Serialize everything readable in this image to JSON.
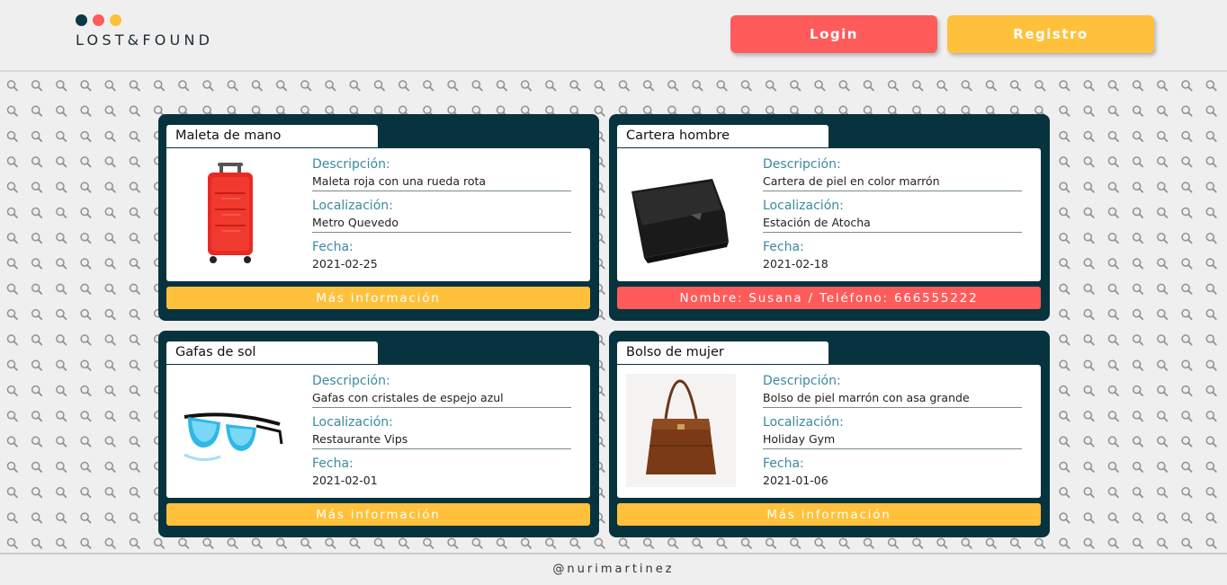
{
  "header": {
    "logo_text": "LOST&FOUND",
    "logo_dots": [
      "#0b3a47",
      "#ff5b5b",
      "#ffc13b"
    ],
    "login_label": "Login",
    "register_label": "Registro"
  },
  "colors": {
    "coral": "#ff5b5b",
    "yellow": "#ffc13b",
    "navy": "#07333f",
    "label_teal": "#3a8aa0"
  },
  "background_icon": "magnifier-icon",
  "items": [
    {
      "title": "Maleta de mano",
      "image_icon": "suitcase-image",
      "desc_label": "Descripción:",
      "desc": "Maleta roja con una rueda rota",
      "loc_label": "Localización:",
      "loc": "Metro Quevedo",
      "date_label": "Fecha:",
      "date": "2021-02-25",
      "button": "Más información"
    },
    {
      "title": "Cartera hombre",
      "image_icon": "wallet-image",
      "desc_label": "Descripción:",
      "desc": "Cartera de piel en color marrón",
      "loc_label": "Localización:",
      "loc": "Estación de Atocha",
      "date_label": "Fecha:",
      "date": "2021-02-18",
      "button": "Nombre: Susana / Teléfono: 666555222"
    },
    {
      "title": "Gafas de sol",
      "image_icon": "sunglasses-image",
      "desc_label": "Descripción:",
      "desc": "Gafas con cristales de espejo azul",
      "loc_label": "Localización:",
      "loc": "Restaurante Vips",
      "date_label": "Fecha:",
      "date": "2021-02-01",
      "button": "Más información"
    },
    {
      "title": "Bolso de mujer",
      "image_icon": "handbag-image",
      "desc_label": "Descripción:",
      "desc": "Bolso de piel marrón con asa grande",
      "loc_label": "Localización:",
      "loc": "Holiday Gym",
      "date_label": "Fecha:",
      "date": "2021-01-06",
      "button": "Más información"
    }
  ],
  "footer": {
    "credit": "@nurimartinez"
  }
}
